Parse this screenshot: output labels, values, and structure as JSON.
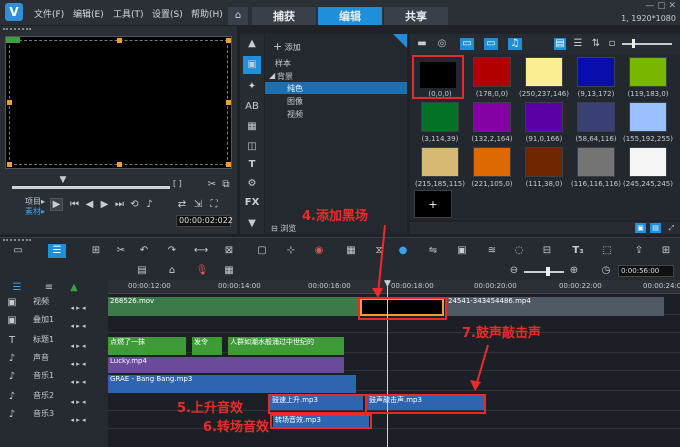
{
  "titlebar": {
    "menus": [
      "文件(F)",
      "编辑(E)",
      "工具(T)",
      "设置(S)",
      "帮助(H)"
    ],
    "tabs": [
      "捕获",
      "编辑",
      "共享"
    ],
    "resolution": "1, 1920*1080"
  },
  "preview": {
    "mode_labels": [
      "项目▸",
      "素材▸"
    ],
    "timecode": "00:00:02:022",
    "brackets": "[ ]"
  },
  "library": {
    "add_label": "添加",
    "tree": [
      "样本",
      "背景",
      "纯色",
      "图像",
      "视频"
    ],
    "browse_label": "浏览",
    "swatches": [
      {
        "label": "(0,0,0)",
        "color": "#000000"
      },
      {
        "label": "(178,0,0)",
        "color": "#b20000"
      },
      {
        "label": "(250,237,146)",
        "color": "#faed92"
      },
      {
        "label": "(9,13,172)",
        "color": "#090dac"
      },
      {
        "label": "(119,183,0)",
        "color": "#77b700"
      },
      {
        "label": "(3,114,39)",
        "color": "#037227"
      },
      {
        "label": "(132,2,164)",
        "color": "#8402a4"
      },
      {
        "label": "(91,0,166)",
        "color": "#5b00a6"
      },
      {
        "label": "(58,64,116)",
        "color": "#3a4074"
      },
      {
        "label": "(155,192,255)",
        "color": "#9bc0ff"
      },
      {
        "label": "(215,185,115)",
        "color": "#d7b973"
      },
      {
        "label": "(221,105,0)",
        "color": "#dd6900"
      },
      {
        "label": "(111,38,0)",
        "color": "#6f2600"
      },
      {
        "label": "(116,116,116)",
        "color": "#747474"
      },
      {
        "label": "(245,245,245)",
        "color": "#f5f5f5"
      }
    ],
    "add_tile": "+"
  },
  "toolbar": {
    "zoom_time": "0:00:56:00"
  },
  "ruler": [
    "00:00:12:00",
    "00:00:14:00",
    "00:00:16:00",
    "00:00:18:00",
    "00:00:20:00",
    "00:00:22:00",
    "00:00:24:00"
  ],
  "tracks": [
    "视频",
    "叠加1",
    "标题1",
    "声音",
    "音乐1",
    "音乐2",
    "音乐3"
  ],
  "clips": {
    "video1": "268526.mov",
    "video2": "24541-343454486.mp4",
    "titles": [
      "点燃了一抹",
      "发令",
      "人群如潮水般涌过中世纪的"
    ],
    "voice": "Lucky.mp4",
    "music1": "GRAE - Bang Bang.mp3",
    "music2a": "鼓速上升.mp3",
    "music2b": "鼓声敲击声.mp3",
    "music3": "转场音效.mp3"
  },
  "annotations": {
    "a4": "4.添加黑场",
    "a5": "5.上升音效",
    "a6": "6.转场音效",
    "a7": "7.鼓声敲击声"
  },
  "colors": {
    "accent": "#1e8fd8",
    "annotation": "#ee2a2a"
  }
}
